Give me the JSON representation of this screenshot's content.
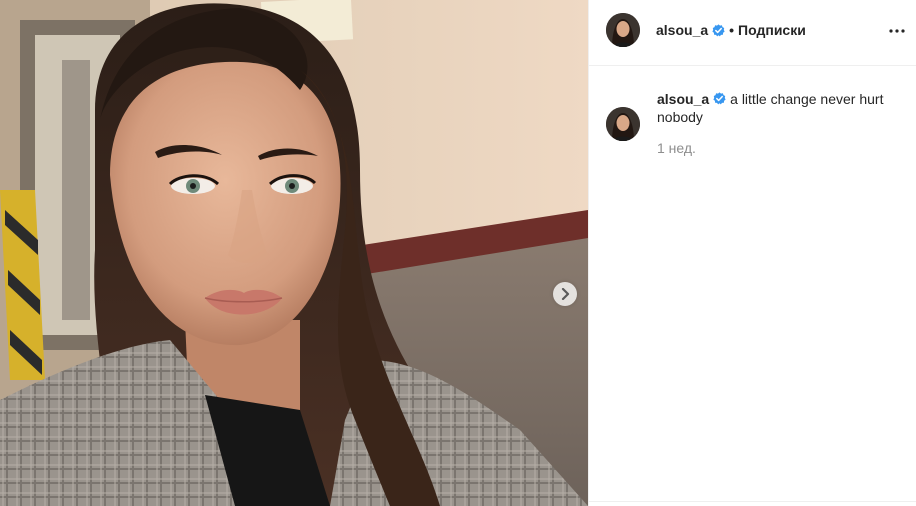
{
  "post": {
    "author": {
      "username": "alsou_a",
      "verified_icon": "verified-badge-icon",
      "follow_separator": "•",
      "follow_label": "Подписки"
    },
    "caption": {
      "username": "alsou_a",
      "text": "a little change never hurt nobody",
      "time": "1 нед."
    },
    "media": {
      "next_icon": "chevron-right-icon"
    },
    "colors": {
      "verified": "#3897f0",
      "muted": "#8e8e8e",
      "border": "#efefef"
    }
  }
}
